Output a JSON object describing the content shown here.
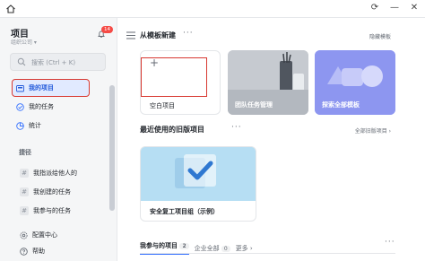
{
  "app": {
    "project_title": "项目",
    "org_name": "组织公司",
    "notification_count": "14"
  },
  "search": {
    "placeholder": "搜索 (Ctrl + K)"
  },
  "sidebar": {
    "items": [
      {
        "label": "我的项目"
      },
      {
        "label": "我的任务"
      },
      {
        "label": "统计"
      }
    ],
    "shortcuts_label": "捷径",
    "shortcuts": [
      {
        "label": "我指派给他人的"
      },
      {
        "label": "我创建的任务"
      },
      {
        "label": "我参与的任务"
      }
    ],
    "footer": [
      {
        "label": "配置中心"
      },
      {
        "label": "帮助"
      }
    ]
  },
  "main": {
    "from_template": "从模板新建",
    "hide_templates": "隐藏模板",
    "templates": [
      {
        "label": "空白项目"
      },
      {
        "label": "团队任务管理"
      },
      {
        "label": "探索全部模板"
      }
    ],
    "recent_title": "最近使用的旧版项目",
    "all_old_projects": "全部旧版项目 ›",
    "recent_project": {
      "name": "安全复工项目组（示例）"
    },
    "tabs": [
      {
        "label": "我参与的项目",
        "count": "2"
      },
      {
        "label": "企业全部",
        "count": "0"
      },
      {
        "label": "更多 ›"
      }
    ]
  },
  "colors": {
    "accent": "#3370ff",
    "highlight_box": "#d83931",
    "badge": "#f54a45"
  },
  "icons": [
    "home-icon",
    "refresh-icon",
    "minimize-icon",
    "close-icon",
    "bell-icon",
    "search-icon",
    "folder-icon",
    "check-circle-icon",
    "chart-icon",
    "settings-icon",
    "help-icon",
    "menu-icon",
    "plus-icon",
    "checkmark-icon"
  ]
}
